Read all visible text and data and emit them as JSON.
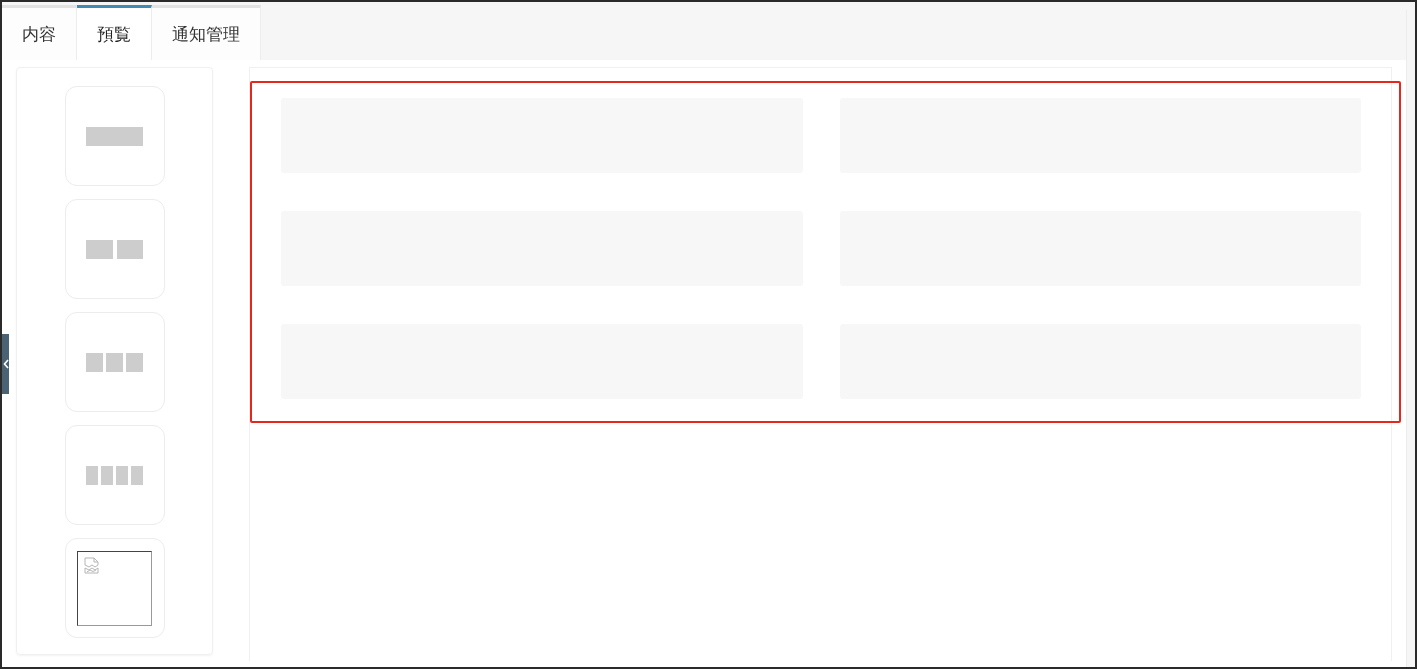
{
  "tabs": [
    {
      "label": "内容",
      "selected": false
    },
    {
      "label": "預覧",
      "selected": true
    },
    {
      "label": "通知管理",
      "selected": false
    }
  ],
  "layout_options": [
    {
      "kind": "single"
    },
    {
      "kind": "double"
    },
    {
      "kind": "triple"
    },
    {
      "kind": "quad"
    },
    {
      "kind": "image"
    }
  ],
  "preview": {
    "highlighted": true,
    "blocks": [
      {
        "kind": "skeleton"
      },
      {
        "kind": "skeleton"
      },
      {
        "kind": "skeleton"
      },
      {
        "kind": "skeleton"
      },
      {
        "kind": "skeleton"
      },
      {
        "kind": "skeleton"
      }
    ]
  }
}
